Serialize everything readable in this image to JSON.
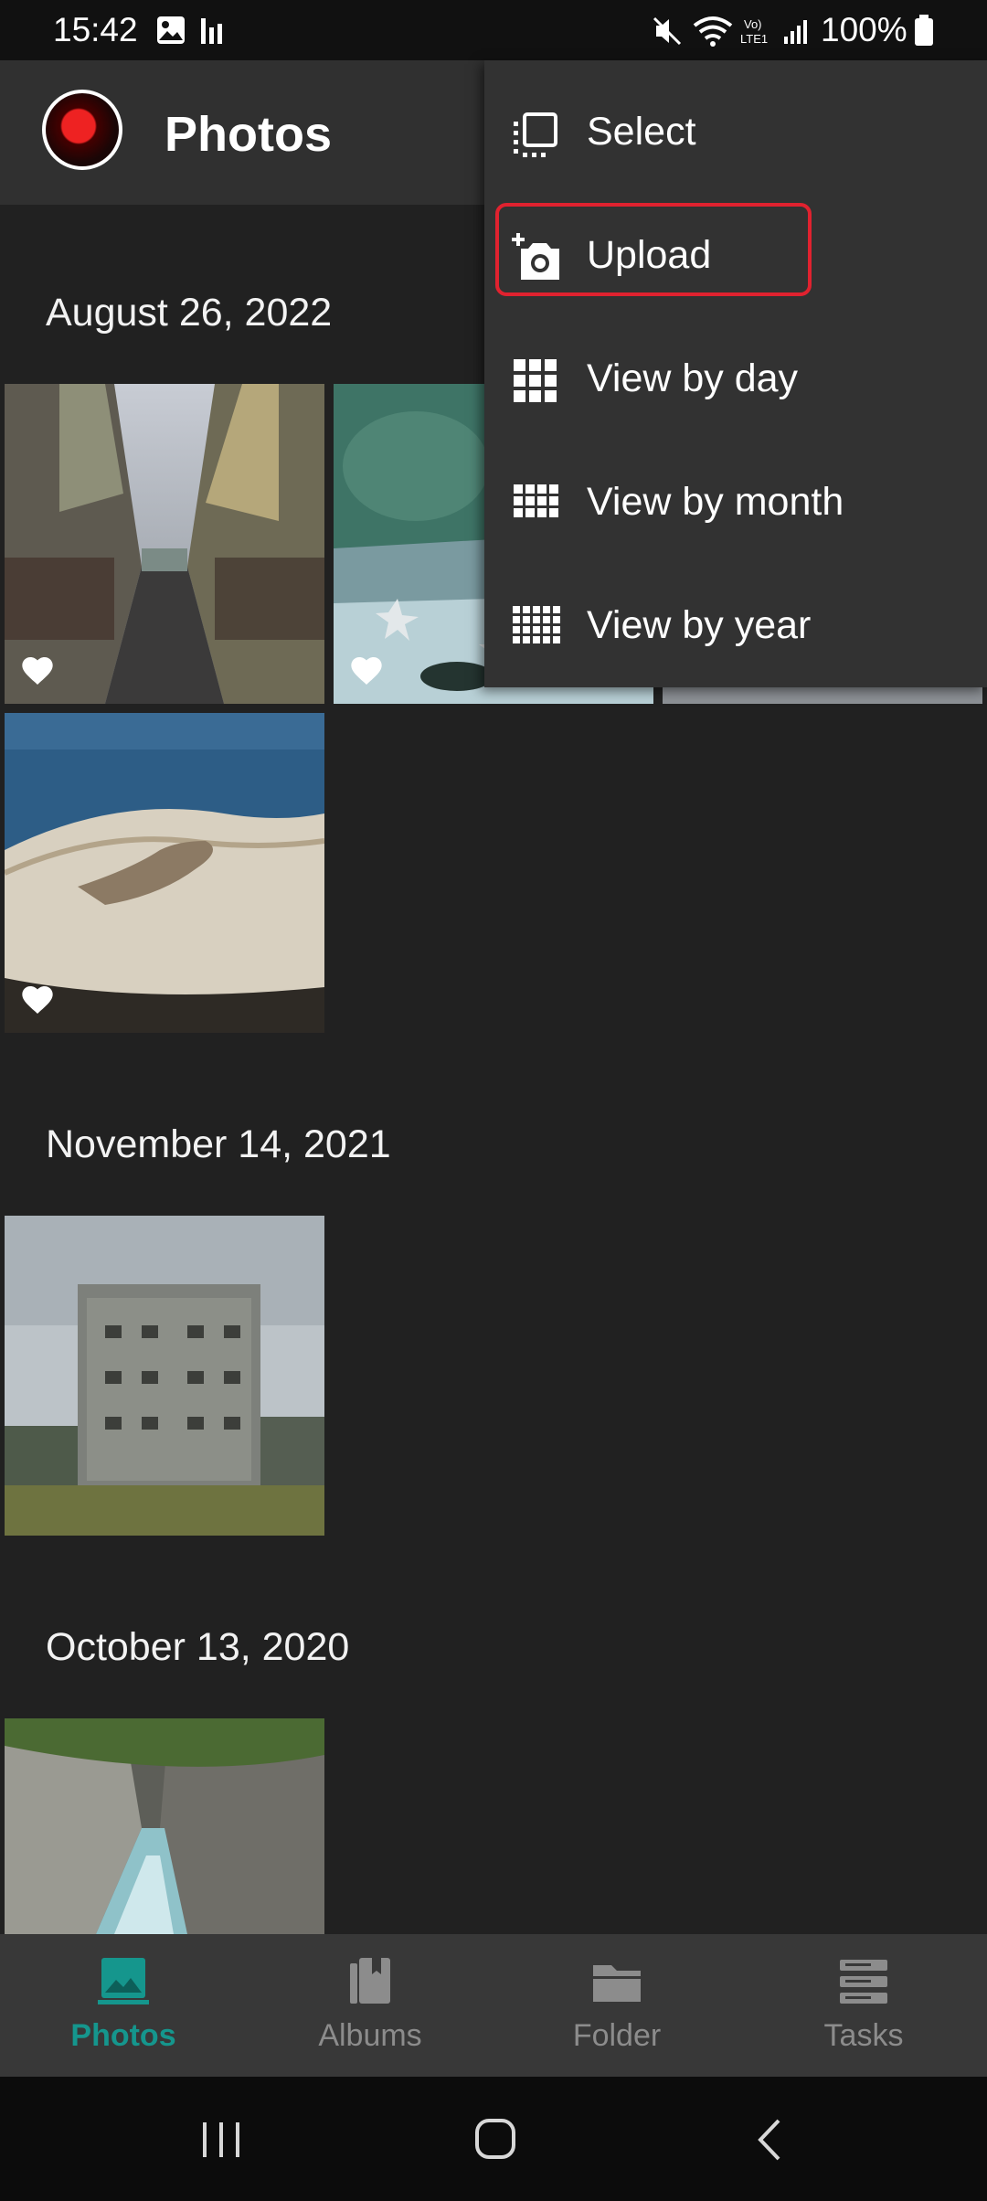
{
  "status_bar": {
    "time": "15:42",
    "battery": "100%",
    "icons": [
      "image-icon",
      "signal-bars-icon",
      "mute-icon",
      "wifi-icon",
      "volte-icon",
      "cell-signal-icon",
      "battery-icon"
    ]
  },
  "app_bar": {
    "title": "Photos",
    "avatar_icon": "dragon-avatar"
  },
  "menu": {
    "items": [
      {
        "label": "Select",
        "icon": "select-icon"
      },
      {
        "label": "Upload",
        "icon": "add-photo-icon"
      },
      {
        "label": "View by day",
        "icon": "grid-3x3-icon"
      },
      {
        "label": "View by month",
        "icon": "grid-4x4-icon"
      },
      {
        "label": "View by year",
        "icon": "grid-5x5-icon"
      }
    ],
    "highlight_color": "#e0222f"
  },
  "sections": [
    {
      "date": "August 26, 2022",
      "photos": [
        "street-market-photo",
        "aquarium-starfish-photo",
        "coast-rock-photo"
      ],
      "favorites": [
        true,
        true,
        true
      ]
    },
    {
      "date": "November 14, 2021",
      "photos": [
        "abandoned-building-photo"
      ],
      "favorites": [
        false
      ]
    },
    {
      "date": "October 13, 2020",
      "photos": [
        "gorge-river-photo"
      ],
      "favorites": [
        false
      ]
    }
  ],
  "bottom_nav": {
    "items": [
      {
        "label": "Photos",
        "icon": "photo-icon",
        "active": true
      },
      {
        "label": "Albums",
        "icon": "album-icon",
        "active": false
      },
      {
        "label": "Folder",
        "icon": "folder-icon",
        "active": false
      },
      {
        "label": "Tasks",
        "icon": "tasks-icon",
        "active": false
      }
    ],
    "active_color": "#15968d",
    "inactive_color": "#8c8c8c"
  },
  "system_nav": {
    "buttons": [
      "recents-button",
      "home-button",
      "back-button"
    ]
  }
}
